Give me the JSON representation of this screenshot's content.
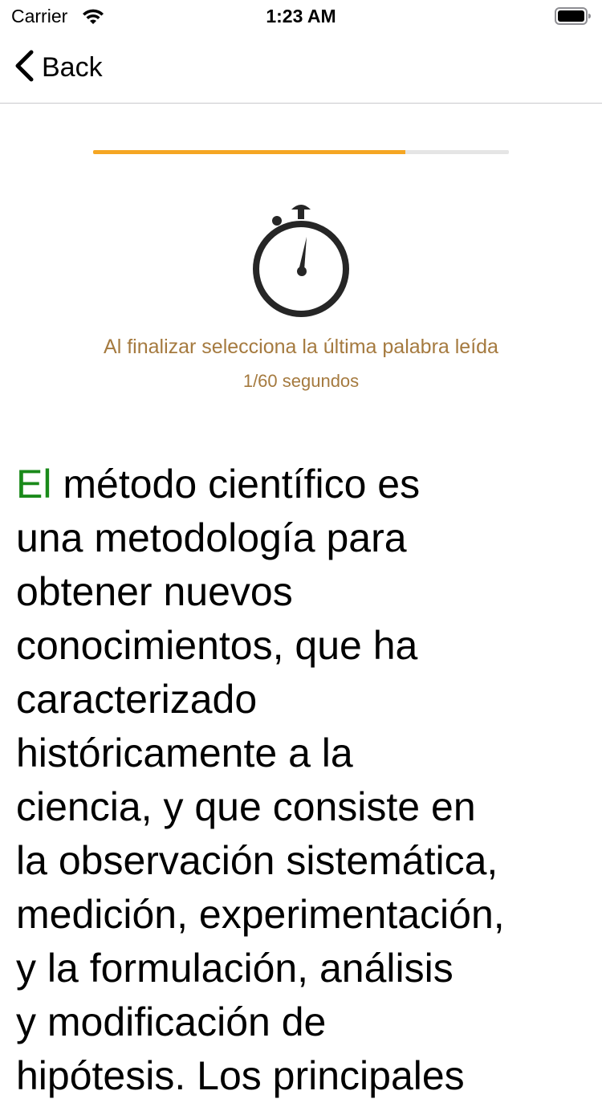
{
  "status_bar": {
    "carrier": "Carrier",
    "time": "1:23 AM"
  },
  "nav": {
    "back_label": "Back"
  },
  "progress": {
    "fraction": 0.75,
    "color": "#f5a623",
    "track_color": "#e5e5e5"
  },
  "instruction": "Al finalizar selecciona la última palabra leída",
  "timer_text": "1/60 segundos",
  "colors": {
    "accent_text": "#a57a3f",
    "current_word": "#1a8a1a"
  },
  "reading": {
    "current_word_index": 0,
    "lines": [
      [
        "El",
        "método",
        "científico",
        "es"
      ],
      [
        "una",
        "metodología",
        "para"
      ],
      [
        "obtener",
        "nuevos"
      ],
      [
        "conocimientos,",
        "que",
        "ha"
      ],
      [
        "caracterizado"
      ],
      [
        "históricamente",
        "a",
        "la"
      ],
      [
        "ciencia,",
        "y",
        "que",
        "consiste",
        "en"
      ],
      [
        "la",
        "observación",
        "sistemática,"
      ],
      [
        "medición,",
        "experimentación,"
      ],
      [
        "y",
        "la",
        "formulación,",
        "análisis"
      ],
      [
        "y",
        "modificación",
        "de"
      ],
      [
        "hipótesis.",
        "Los",
        "principales"
      ]
    ]
  }
}
